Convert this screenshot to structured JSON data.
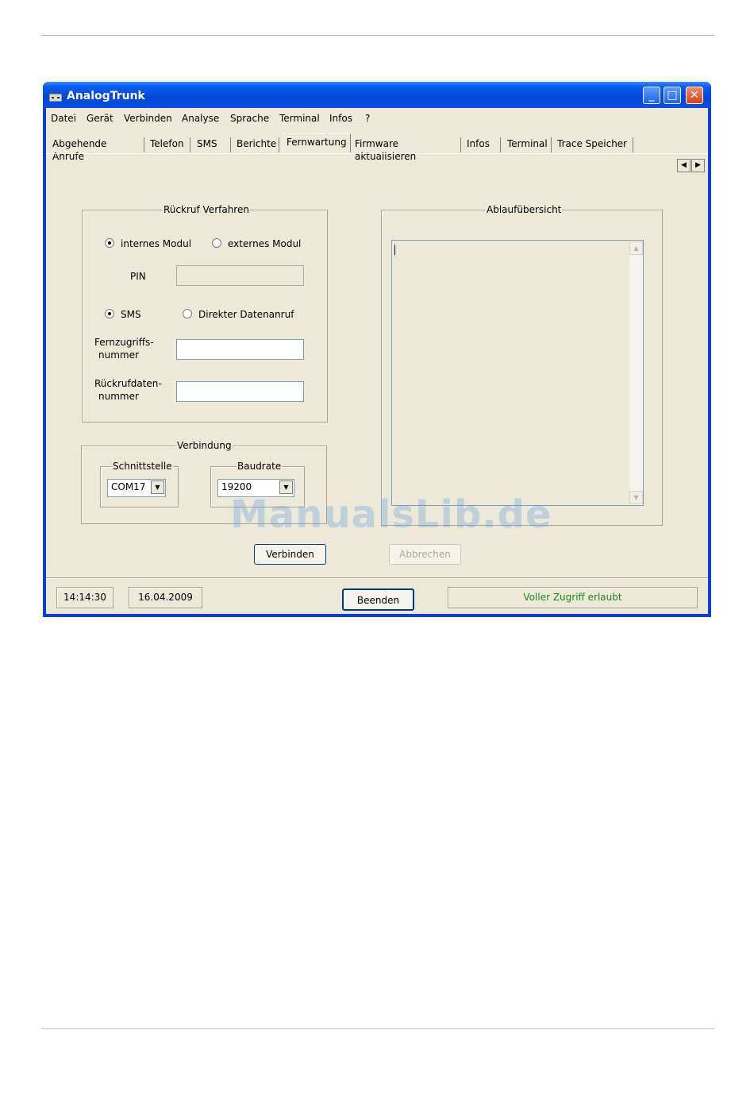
{
  "window": {
    "title": "AnalogTrunk",
    "min_label": "_",
    "max_label": "□",
    "close_label": "✕"
  },
  "menu": [
    "Datei",
    "Gerät",
    "Verbinden",
    "Analyse",
    "Sprache",
    "Terminal",
    "Infos",
    "?"
  ],
  "tabs": [
    "Abgehende Anrufe",
    "Telefon",
    "SMS",
    "Berichte",
    "Fernwartung",
    "Firmware aktualisieren",
    "Infos",
    "Terminal",
    "Trace Speicher"
  ],
  "active_tab": "Fernwartung",
  "callback": {
    "group_label": "Rückruf Verfahren",
    "radio_internal": "internes Modul",
    "radio_external": "externes Modul",
    "pin_label": "PIN",
    "pin_value": "",
    "radio_sms": "SMS",
    "radio_direct": "Direkter Datenanruf",
    "remote_number_label_1": "Fernzugriffs-",
    "remote_number_label_2": "nummer",
    "remote_number_value": "",
    "callback_number_label_1": "Rückrufdaten-",
    "callback_number_label_2": "nummer",
    "callback_number_value": ""
  },
  "connection": {
    "group_label": "Verbindung",
    "interface_label": "Schnittstelle",
    "interface_value": "COM17",
    "baud_label": "Baudrate",
    "baud_value": "19200"
  },
  "log": {
    "group_label": "Ablaufübersicht",
    "content": ""
  },
  "buttons": {
    "connect": "Verbinden",
    "cancel": "Abbrechen",
    "exit": "Beenden"
  },
  "status": {
    "time": "14:14:30",
    "date": "16.04.2009",
    "access": "Voller Zugriff erlaubt",
    "access_color": "#1a8a1a"
  },
  "watermark": "ManualsLib.de"
}
